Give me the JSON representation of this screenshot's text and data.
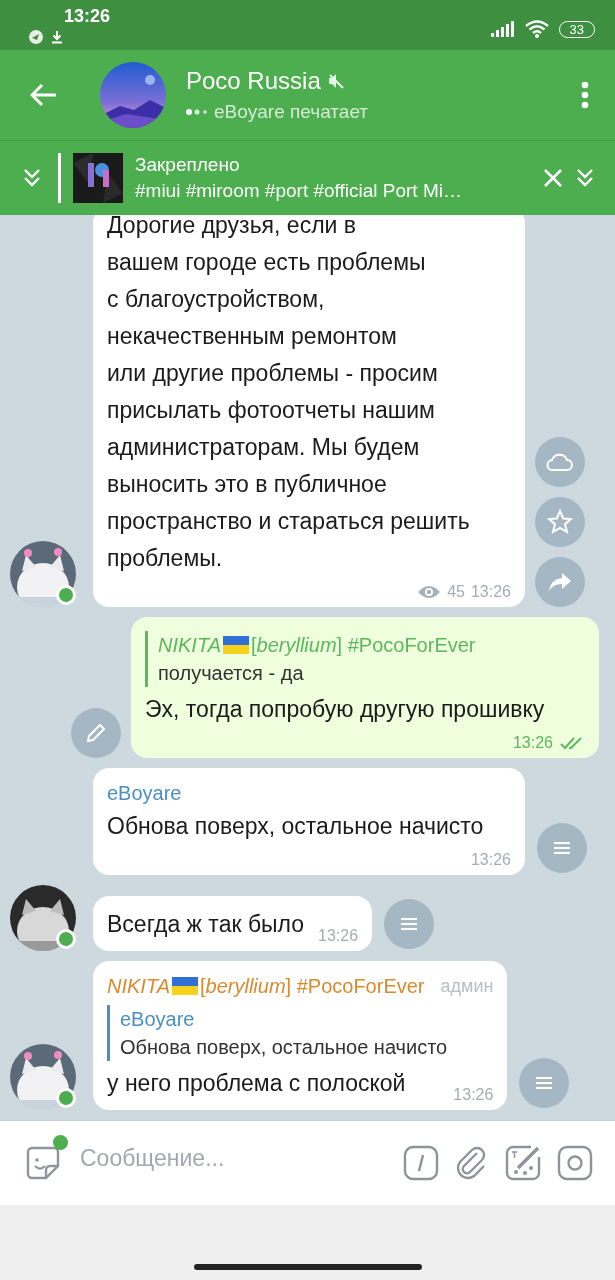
{
  "status_bar": {
    "time": "13:26",
    "battery": "33"
  },
  "header": {
    "title": "Poco Russia",
    "muted": true,
    "typing": "eBoyare печатает"
  },
  "pinned": {
    "label": "Закреплено",
    "text": "#miui #miroom #port #official Port Mi…"
  },
  "messages": [
    {
      "kind": "channel",
      "avatar": true,
      "online": true,
      "text": "Дорогие друзья, если в\nвашем городе есть проблемы\nс благоустройством,\nнекачественным ремонтом\nили другие проблемы - просим\nприсылать фотоотчеты нашим\nадминистраторам. Мы будем\nвыносить это в публичное\nпространство и стараться решить\nпроблемы.",
      "views": "45",
      "time": "13:26"
    },
    {
      "kind": "outgoing",
      "reply": {
        "name": "NIKITA",
        "flag": true,
        "tag": "[*beryllium*] #PocoForEver",
        "color": "#5cb85c",
        "text": "получается - да"
      },
      "text": "Эх, тогда попробую другую прошивку",
      "time": "13:26",
      "read": true
    },
    {
      "kind": "incoming",
      "sender": {
        "name": "eBoyare",
        "color": "#4a8fc4"
      },
      "text": "Обнова поверх, остальное начисто",
      "time": "13:26"
    },
    {
      "kind": "incoming",
      "avatar": true,
      "online": true,
      "text": "Всегда ж так было",
      "time": "13:26"
    },
    {
      "kind": "incoming",
      "avatar": true,
      "online": true,
      "sender": {
        "name": "NIKITA",
        "flag": true,
        "tag": "[*beryllium*] #PocoForEver",
        "color": "#d98a2e"
      },
      "badge": "админ",
      "reply": {
        "name": "eBoyare",
        "color": "#4a8fc4",
        "text": "Обнова поверх, остальное начисто"
      },
      "text": "у него проблема с полоской",
      "time": "13:26"
    }
  ],
  "composer": {
    "placeholder": "Сообщение..."
  }
}
